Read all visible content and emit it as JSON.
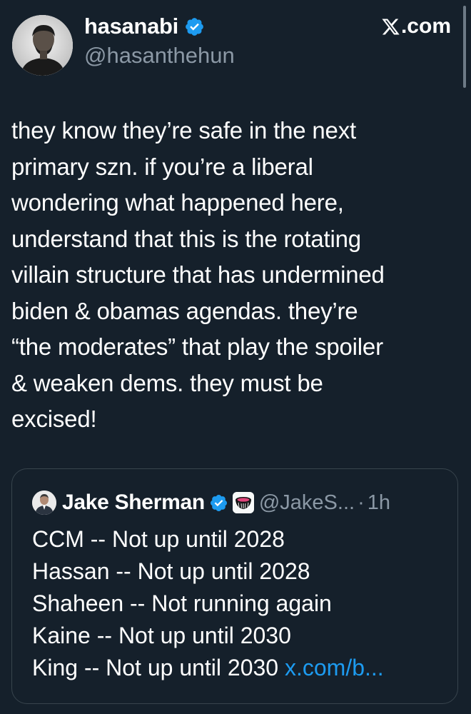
{
  "author": {
    "display_name": "hasanabi",
    "handle": "@hasanthehun",
    "verified": true
  },
  "site": {
    "label": ".com",
    "logo_icon": "x-logo-icon"
  },
  "tweet": {
    "text": "they know they’re safe in the next\nprimary szn. if you’re a liberal\nwondering what happened here,\nunderstand that this is the rotating\nvillain structure that has undermined\nbiden & obamas agendas. they’re\n“the moderates” that play the spoiler\n& weaken dems. they must be\nexcised!"
  },
  "quoted_tweet": {
    "display_name": "Jake Sherman",
    "handle": "@JakeS...",
    "separator": "·",
    "time": "1h",
    "verified": true,
    "affiliation_badge": "punchbowl-logo-icon",
    "lines": [
      "CCM -- Not up until 2028",
      "Hassan -- Not up until 2028",
      "Shaheen -- Not running again",
      "Kaine -- Not up until 2030",
      "King -- Not up until 2030 "
    ],
    "link": "x.com/b..."
  },
  "colors": {
    "background": "#15202b",
    "text": "#ffffff",
    "secondary_text": "#8b98a5",
    "link": "#1d9bf0",
    "verified_badge": "#1d9bf0",
    "card_border": "#38444d"
  }
}
